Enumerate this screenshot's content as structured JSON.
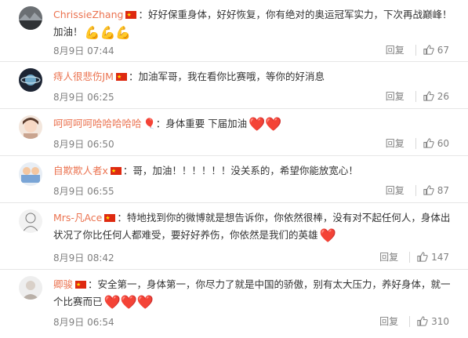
{
  "reply_label": "回复",
  "colors": {
    "name": "#eb7350",
    "heart": "#e0245e",
    "meta": "#808080"
  },
  "comments": [
    {
      "name": "ChrissieZhang",
      "text": "：好好保重身体，好好恢复，你有绝对的奥运冠军实力，下次再战巅峰！加油！",
      "emoji": "💪💪💪",
      "time": "8月9日 07:44",
      "likes": "67",
      "avatar_icon": "landscape-avatar"
    },
    {
      "name": "痔人很悲伤JM",
      "text": "：加油军哥，我在看你比赛哦，等你的好消息",
      "emoji": "",
      "time": "8月9日 06:25",
      "likes": "26",
      "avatar_icon": "planet-avatar"
    },
    {
      "name": "呵呵呵呵哈哈哈哈哈",
      "text": "：身体重要 下届加油",
      "emoji": "❤️❤️",
      "time": "8月9日 06:50",
      "likes": "60",
      "avatar_icon": "girl-avatar"
    },
    {
      "name": "自欺欺人者x",
      "text": "：哥，加油！！！！！！没关系的，希望你能放宽心！",
      "emoji": "",
      "time": "8月9日 06:55",
      "likes": "87",
      "avatar_icon": "cartoon-avatar"
    },
    {
      "name": "Mrs-凡Ace",
      "text": "：特地找到你的微博就是想告诉你，你依然很棒，没有对不起任何人，身体出状况了你比任何人都难受，要好好养伤，你依然是我们的英雄",
      "emoji": "❤️",
      "time": "8月9日 08:42",
      "likes": "147",
      "avatar_icon": "sketch-avatar"
    },
    {
      "name": "卿骏",
      "text": "：安全第一，身体第一，你尽力了就是中国的骄傲，别有太大压力，养好身体，就一个比赛而已",
      "emoji": "❤️❤️❤️",
      "time": "8月9日 06:54",
      "likes": "310",
      "avatar_icon": "portrait-avatar"
    }
  ]
}
